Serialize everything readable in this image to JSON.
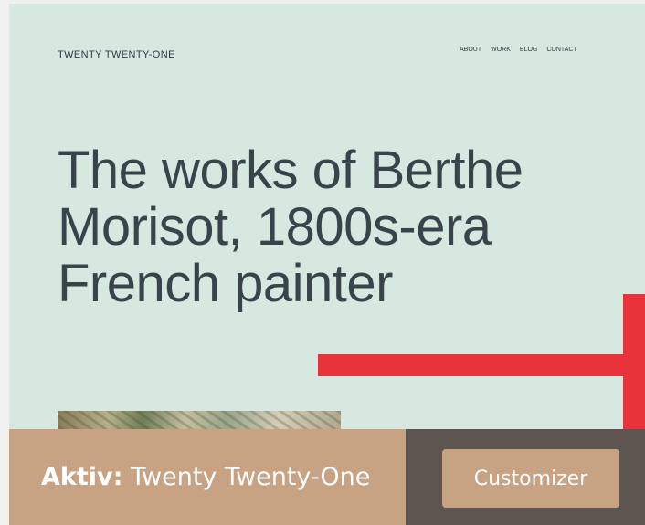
{
  "site": {
    "title": "TWENTY TWENTY-ONE",
    "nav": [
      "ABOUT",
      "WORK",
      "BLOG",
      "CONTACT"
    ]
  },
  "headline": {
    "lines": [
      "The works of Berthe",
      "Morisot, 1800s-era",
      "French painter"
    ]
  },
  "footer": {
    "active_label": "Aktiv:",
    "theme_name": "Twenty Twenty-One",
    "customizer_button": "Customizer"
  },
  "colors": {
    "preview_bg": "#d6e8e0",
    "accent": "#c7a384",
    "footer_dark": "#5d5550",
    "arrow": "#e8333b"
  },
  "icons": [
    "red-arrow-icon"
  ]
}
